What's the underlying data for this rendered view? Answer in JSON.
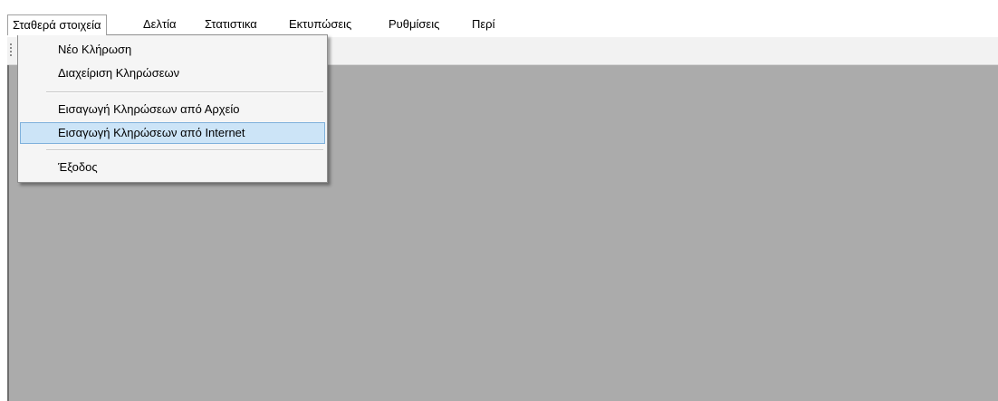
{
  "menubar": {
    "items": [
      {
        "label": "Σταθερά στοιχεία"
      },
      {
        "label": "Δελτία"
      },
      {
        "label": "Στατιστικα"
      },
      {
        "label": "Εκτυπώσεις"
      },
      {
        "label": "Ρυθμίσεις"
      },
      {
        "label": "Περί"
      }
    ]
  },
  "dropdown": {
    "items": [
      {
        "label": "Νέο Κλήρωση"
      },
      {
        "label": "Διαχείριση Κληρώσεων"
      },
      {
        "label": "Εισαγωγή Κληρώσεων από Αρχείο"
      },
      {
        "label": "Εισαγωγή Κληρώσεων από Internet"
      },
      {
        "label": "Έξοδος"
      }
    ],
    "highlighted_item": "Εισαγωγή Κληρώσεων από Internet"
  },
  "colors": {
    "client_background": "#ababab",
    "highlight": "#cce4f7",
    "highlight_border": "#7fb1dc"
  }
}
